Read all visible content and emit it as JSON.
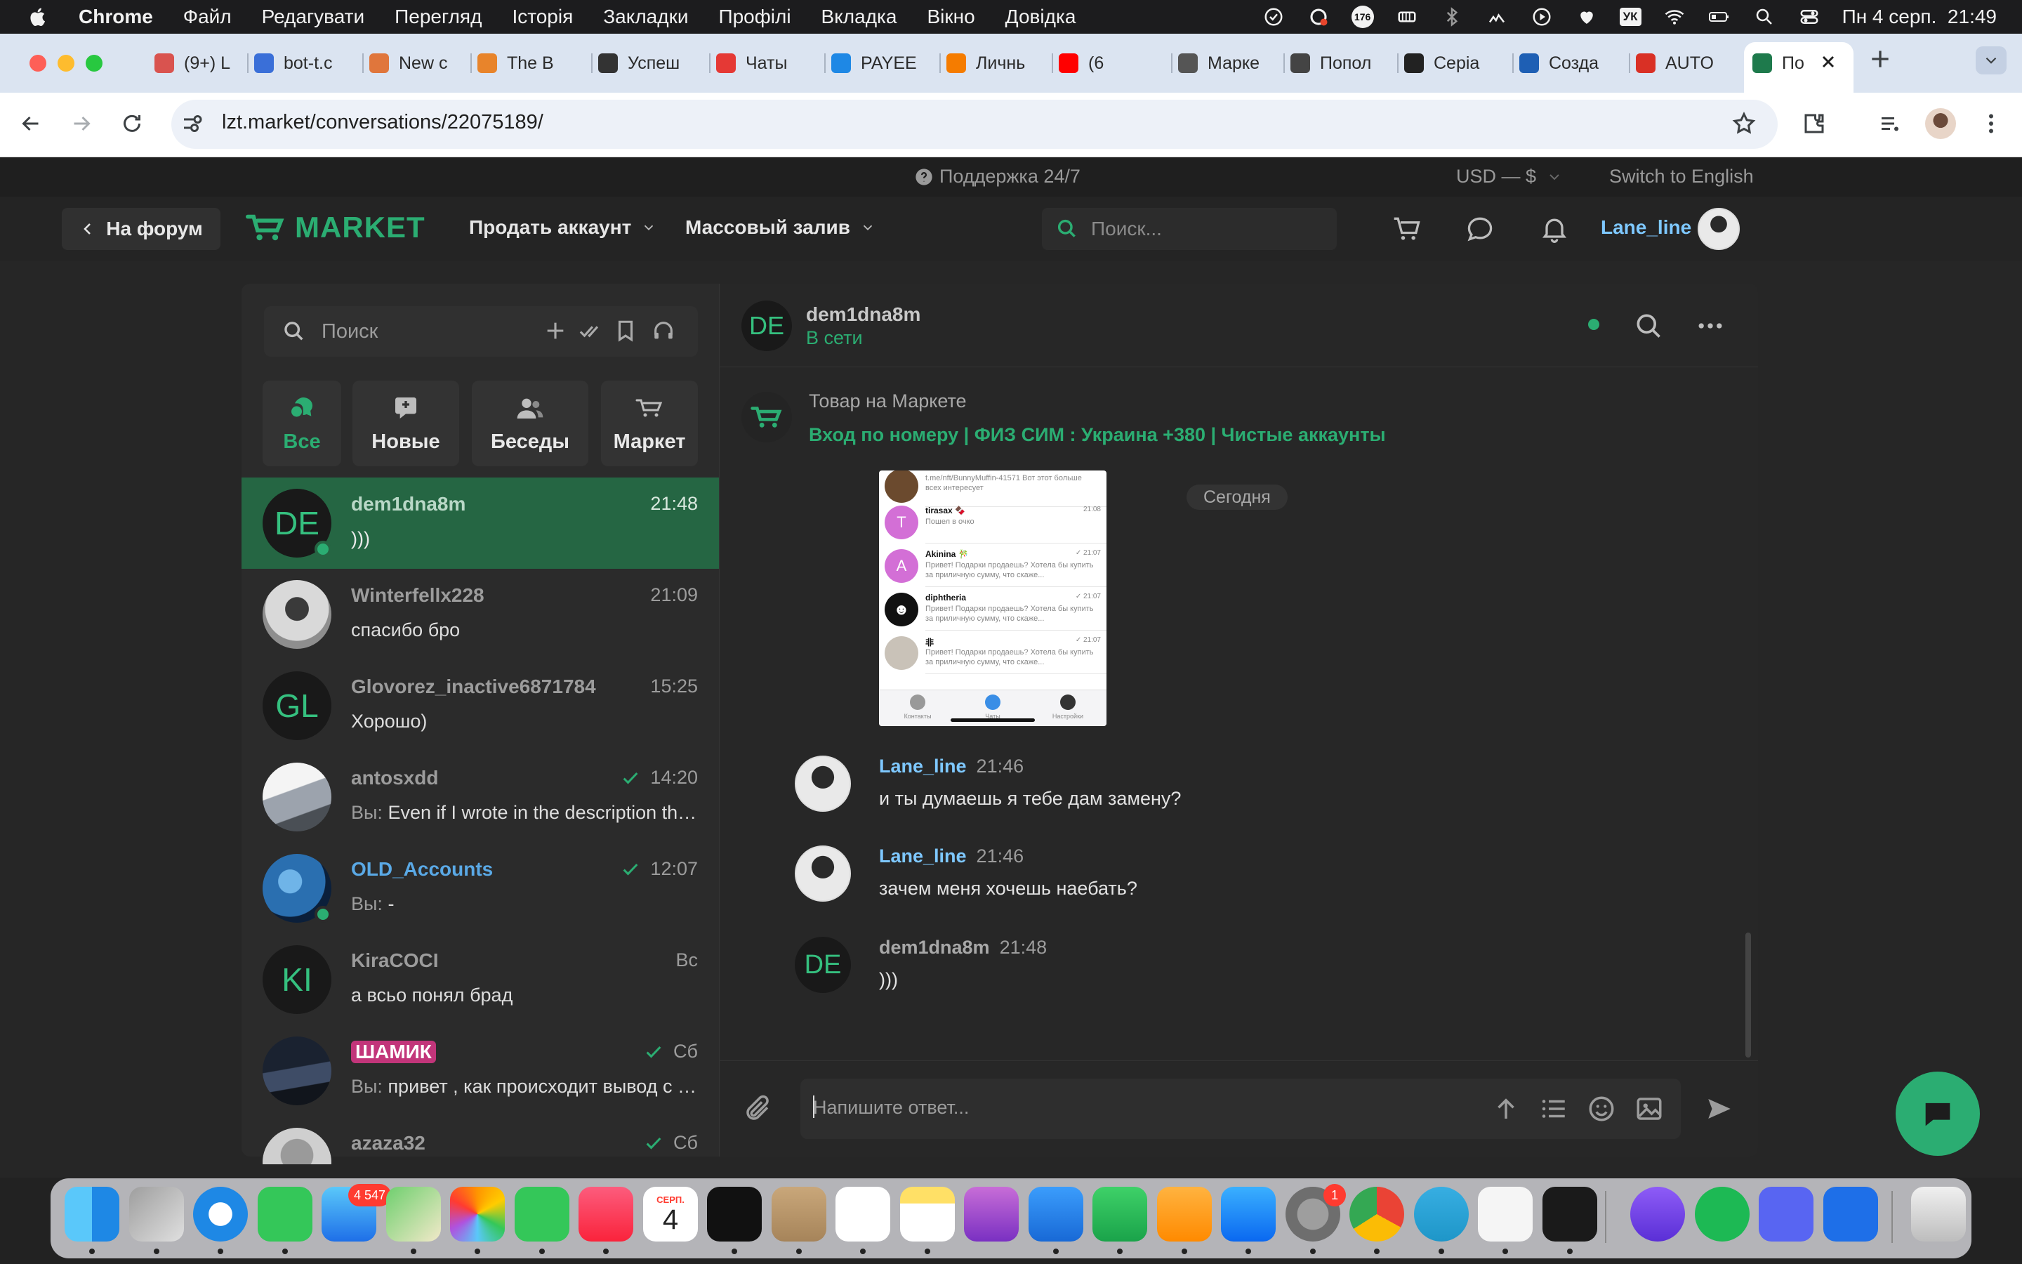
{
  "menubar": {
    "app": "Chrome",
    "items": [
      "Файл",
      "Редагувати",
      "Перегляд",
      "Історія",
      "Закладки",
      "Профілі",
      "Вкладка",
      "Вікно",
      "Довідка"
    ],
    "badge_count": "176",
    "keyboard_layout": "УК",
    "datetime": "Пн 4 серп.  21:49"
  },
  "browser": {
    "tabs": [
      {
        "title": "(9+) L",
        "icon": "hot-springs-icon",
        "color": "#d9534f"
      },
      {
        "title": "bot-t.c",
        "icon": "bot-icon",
        "color": "#3a6fd8"
      },
      {
        "title": "New c",
        "icon": "p-icon",
        "color": "#e0763c"
      },
      {
        "title": "The B",
        "icon": "fire-icon",
        "color": "#e8842b"
      },
      {
        "title": "Успеш",
        "icon": "mask-icon",
        "color": "#333333"
      },
      {
        "title": "Чаты",
        "icon": "hashtag-icon",
        "color": "#e53935"
      },
      {
        "title": "PAYEE",
        "icon": "p-icon",
        "color": "#1e88e5"
      },
      {
        "title": "Личнь",
        "icon": "fox-icon",
        "color": "#f57c00"
      },
      {
        "title": "(6",
        "icon": "youtube-icon",
        "color": "#ff0000"
      },
      {
        "title": "Марке",
        "icon": "globe-icon",
        "color": "#555555"
      },
      {
        "title": "Попол",
        "icon": "circle-icon",
        "color": "#444444"
      },
      {
        "title": "Серia",
        "icon": "film-icon",
        "color": "#222222"
      },
      {
        "title": "Созда",
        "icon": "swirl-icon",
        "color": "#1e5fb4"
      },
      {
        "title": "AUTO",
        "icon": "mail-icon",
        "color": "#d93025"
      },
      {
        "title": "По",
        "icon": "market-icon",
        "color": "#1e7a4c"
      }
    ],
    "url": "lzt.market/conversations/22075189/"
  },
  "site": {
    "support": "Поддержка 24/7",
    "currency": "USD — $",
    "switch_lang": "Switch to English",
    "forum_button": "На форум",
    "logo_text": "MARKET",
    "nav": [
      "Продать аккаунт",
      "Массовый залив"
    ],
    "search_placeholder": "Поиск...",
    "username": "Lane_line"
  },
  "conversations": {
    "search_placeholder": "Поиск",
    "filters": [
      "Все",
      "Новые",
      "Беседы",
      "Маркет"
    ],
    "items": [
      {
        "name": "dem1dna8m",
        "initials": "DE",
        "time": "21:48",
        "preview": ")))",
        "online": true
      },
      {
        "name": "Winterfellx228",
        "time": "21:09",
        "preview": "спасибо бро"
      },
      {
        "name": "Glovorez_inactive6871784",
        "initials": "GL",
        "time": "15:25",
        "preview": "Хорошо)"
      },
      {
        "name": "antosxdd",
        "time": "14:20",
        "you": "Вы:",
        "preview": "Even if I wrote in the description that the accounts wer",
        "read": true
      },
      {
        "name": "OLD_Accounts",
        "time": "12:07",
        "you": "Вы:",
        "preview": "-",
        "read": true,
        "online": true
      },
      {
        "name": "KiraCOCI",
        "initials": "KI",
        "time": "Вс",
        "preview": "а всьо понял брад"
      },
      {
        "name": "ШАМИК",
        "time": "Сб",
        "you": "Вы:",
        "preview": "привет , как происходит вывод с маркета",
        "read": true
      },
      {
        "name": "azaza32",
        "time": "Сб",
        "preview": "",
        "read": true
      }
    ]
  },
  "chat": {
    "name": "dem1dna8m",
    "initials": "DE",
    "status": "В сети",
    "product_label": "Товар на Маркете",
    "product_title": "Вход по номеру | ФИЗ СИМ : Украина +380 | Чистые аккаунты",
    "date_divider": "Сегодня",
    "screenshot": {
      "rows": [
        {
          "name": "",
          "initial": "",
          "time": "",
          "msg": "t.me/nft/BunnyMuffin-41571 Вот этот больше всех интересует",
          "color": "#6b4a2e"
        },
        {
          "name": "tirasax 🍫",
          "initial": "T",
          "time": "21:08",
          "msg": "Пошел в очко",
          "color": "#d36fd6"
        },
        {
          "name": "Akinina 🎋",
          "initial": "A",
          "time": "✓ 21:07",
          "msg": "Привет! Подарки продаешь? Хотела бы купить за приличную сумму, что скаже...",
          "color": "#d36fd6"
        },
        {
          "name": "diphtheria",
          "initial": "☻",
          "time": "✓ 21:07",
          "msg": "Привет! Подарки продаешь? Хотела бы купить за приличную сумму, что скаже...",
          "color": "#111111"
        },
        {
          "name": "非",
          "initial": "",
          "time": "✓ 21:07",
          "msg": "Привет! Подарки продаешь? Хотела бы купить за приличную сумму, что скаже...",
          "color": "#c9c2b8"
        }
      ],
      "tabbar": [
        "Контакты",
        "Чаты",
        "Настройки"
      ]
    },
    "messages": [
      {
        "author": "Lane_line",
        "time": "21:46",
        "text": "и ты думаешь я тебе дам замену?",
        "mine": true
      },
      {
        "author": "Lane_line",
        "time": "21:46",
        "text": "зачем меня хочешь наебать?",
        "mine": true
      },
      {
        "author": "dem1dna8m",
        "initials": "DE",
        "time": "21:48",
        "text": ")))",
        "mine": false
      }
    ],
    "composer_placeholder": "Напишите ответ..."
  },
  "dock": {
    "mail_badge": "4 547",
    "calendar_month": "СЕРП.",
    "calendar_day": "4",
    "settings_badge": "1",
    "apps": [
      "finder-icon",
      "launchpad-icon",
      "safari-icon",
      "messages-icon",
      "mail-icon",
      "maps-icon",
      "photos-icon",
      "facetime-icon",
      "music-icon",
      "calendar-icon",
      "appletv-icon",
      "contacts-icon",
      "reminders-icon",
      "notes-icon",
      "podcasts-icon",
      "keynote-icon",
      "numbers-icon",
      "pages-icon",
      "appstore-icon",
      "settings-icon",
      "chrome-icon",
      "telegram-icon",
      "textedit-icon",
      "terminal-icon",
      "d-app-icon",
      "spotify-icon",
      "discord-icon",
      "s-app-icon",
      "trash-icon"
    ]
  },
  "colors": {
    "accent": "#2bad72",
    "active_conv": "#256643",
    "link_user": "#7ec8ff"
  }
}
